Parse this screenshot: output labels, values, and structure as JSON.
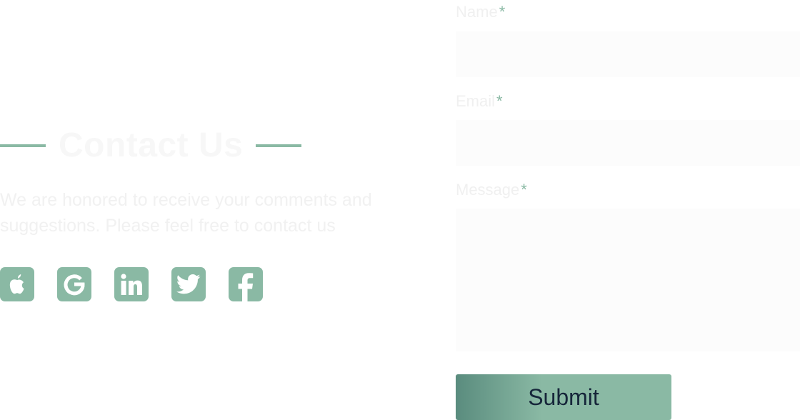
{
  "contact": {
    "title": "Contact Us",
    "intro": "We are honored to receive your comments and suggestions. Please feel free to contact us"
  },
  "socials": [
    {
      "icon": "apple-icon"
    },
    {
      "icon": "google-icon"
    },
    {
      "icon": "linkedin-icon"
    },
    {
      "icon": "twitter-icon"
    },
    {
      "icon": "facebook-icon"
    }
  ],
  "form": {
    "name_label": "Name",
    "email_label": "Email",
    "message_label": "Message",
    "required_mark": "*",
    "name_value": "",
    "email_value": "",
    "message_value": "",
    "submit_label": "Submit"
  },
  "colors": {
    "accent": "#8ab9a4",
    "accent_dark": "#5a8c7e",
    "submit_text": "#16263a"
  }
}
